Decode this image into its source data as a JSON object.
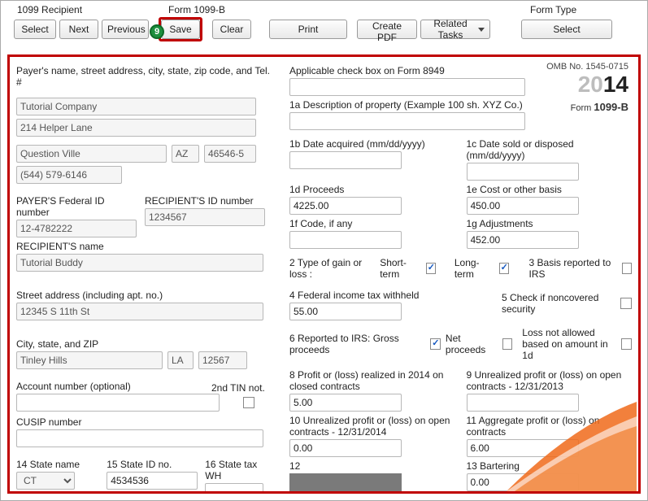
{
  "toolbar": {
    "headers": {
      "recipient": "1099 Recipient",
      "form": "Form 1099-B",
      "type": "Form Type"
    },
    "select": "Select",
    "next": "Next",
    "previous": "Previous",
    "save": "Save",
    "clear": "Clear",
    "print": "Print",
    "create_pdf": "Create PDF",
    "related": "Related Tasks",
    "select2": "Select",
    "step_number": "9"
  },
  "left": {
    "payer_header": "Payer's name, street address, city, state, zip code, and Tel. #",
    "company": "Tutorial Company",
    "street1": "214 Helper Lane",
    "city1": "Question Ville",
    "state1": "AZ",
    "zip1": "46546-5",
    "phone": "(544) 579-6146",
    "payer_id_label": "PAYER'S Federal ID number",
    "payer_id": "12-4782222",
    "recip_id_label": "RECIPIENT'S ID number",
    "recip_id": "1234567",
    "recip_name_label": "RECIPIENT'S name",
    "recip_name": "Tutorial Buddy",
    "street2_label": "Street address (including apt. no.)",
    "street2": "12345 S 11th St",
    "csz_label": "City, state, and ZIP",
    "city2": "Tinley Hills",
    "state2": "LA",
    "zip2": "12567",
    "acct_label": "Account number (optional)",
    "tin2_label": "2nd TIN not.",
    "cusip_label": "CUSIP number",
    "f14_label": "14 State name",
    "f14": "CT",
    "f15_label": "15 State ID no.",
    "f15": "4534536",
    "f16_label": "16 State tax WH"
  },
  "right": {
    "omb": "OMB No. 1545-0715",
    "year_gray": "20",
    "year_bold": "14",
    "form_label": "Form",
    "form_name": "1099-B",
    "appl_label": "Applicable check box on Form 8949",
    "desc_label": "1a Description of property (Example 100 sh. XYZ Co.)",
    "b_label": "1b Date acquired (mm/dd/yyyy)",
    "c_label": "1c Date sold or disposed (mm/dd/yyyy)",
    "d_label": "1d Proceeds",
    "d_val": "4225.00",
    "e_label": "1e Cost or other basis",
    "e_val": "450.00",
    "f_label": "1f Code, if any",
    "g_label": "1g Adjustments",
    "g_val": "452.00",
    "type_label": "2 Type of gain or loss :",
    "short_label": "Short-term",
    "long_label": "Long-term",
    "basis_label": "3 Basis reported to IRS",
    "fed_label": "4 Federal income tax withheld",
    "fed_val": "55.00",
    "noncov_label": "5 Check if noncovered security",
    "rep_label": "6 Reported to IRS: Gross proceeds",
    "net_label": "Net proceeds",
    "loss_label": "Loss not allowed based on amount in 1d",
    "f8_label": "8 Profit or (loss) realized in 2014 on closed contracts",
    "f8_val": "5.00",
    "f9_label": "9 Unrealized profit or (loss) on open contracts - 12/31/2013",
    "f10_label": "10 Unrealized profit or (loss) on open contracts - 12/31/2014",
    "f10_val": "0.00",
    "f11_label": "11 Aggregate profit or (loss) on contracts",
    "f11_val": "6.00",
    "f12_label": "12",
    "f13_label": "13 Bartering",
    "f13_val": "0.00"
  }
}
